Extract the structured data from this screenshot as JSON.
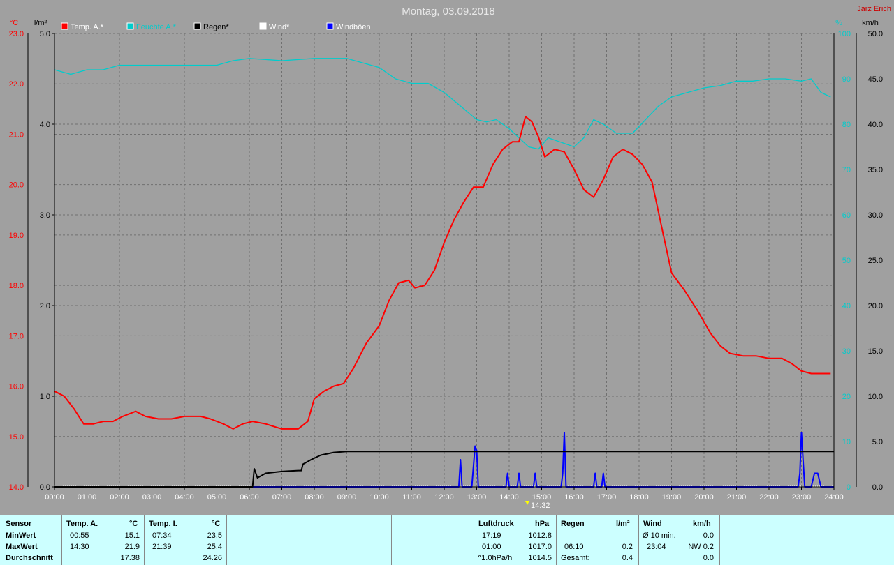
{
  "title": "Montag, 03.09.2018",
  "author": "Jarz Erich",
  "cursor_time": "14:32",
  "colors": {
    "temp": "#ff0000",
    "humidity": "#00cccc",
    "rain": "#000000",
    "wind": "#ffffff",
    "gust": "#0000ff",
    "background": "#a0a0a0",
    "grid": "#707070",
    "stats_bg": "#ccffff"
  },
  "chart_data": {
    "type": "line",
    "title": "Montag, 03.09.2018",
    "x_labels": [
      "00:00",
      "01:00",
      "02:00",
      "03:00",
      "04:00",
      "05:00",
      "06:00",
      "07:00",
      "08:00",
      "09:00",
      "10:00",
      "11:00",
      "12:00",
      "13:00",
      "14:00",
      "15:00",
      "16:00",
      "17:00",
      "18:00",
      "19:00",
      "20:00",
      "21:00",
      "22:00",
      "23:00",
      "24:00"
    ],
    "axes": {
      "temp": {
        "unit": "°C",
        "range": [
          14.0,
          23.0
        ],
        "ticks": [
          "14.0",
          "15.0",
          "16.0",
          "17.0",
          "18.0",
          "19.0",
          "20.0",
          "21.0",
          "22.0",
          "23.0"
        ]
      },
      "rain": {
        "unit": "l/m²",
        "range": [
          0.0,
          5.0
        ],
        "ticks": [
          "0.0",
          "1.0",
          "2.0",
          "3.0",
          "4.0",
          "5.0"
        ]
      },
      "humidity": {
        "unit": "%",
        "range": [
          0,
          100
        ],
        "ticks": [
          "0",
          "10",
          "20",
          "30",
          "40",
          "50",
          "60",
          "70",
          "80",
          "90",
          "100"
        ]
      },
      "wind": {
        "unit": "km/h",
        "range": [
          0.0,
          50.0
        ],
        "ticks": [
          "0.0",
          "5.0",
          "10.0",
          "15.0",
          "20.0",
          "25.0",
          "30.0",
          "35.0",
          "40.0",
          "45.0",
          "50.0"
        ]
      }
    },
    "legend": [
      "Temp. A.*",
      "Feuchte A.*",
      "Regen*",
      "Wind*",
      "Windböen"
    ],
    "grid": true,
    "series": [
      {
        "name": "Temp. A.*",
        "axis": "temp",
        "points": [
          [
            0.0,
            15.9
          ],
          [
            0.3,
            15.8
          ],
          [
            0.6,
            15.55
          ],
          [
            0.9,
            15.25
          ],
          [
            1.2,
            15.25
          ],
          [
            1.5,
            15.3
          ],
          [
            1.8,
            15.3
          ],
          [
            2.1,
            15.4
          ],
          [
            2.5,
            15.5
          ],
          [
            2.8,
            15.4
          ],
          [
            3.2,
            15.35
          ],
          [
            3.6,
            15.35
          ],
          [
            4.0,
            15.4
          ],
          [
            4.5,
            15.4
          ],
          [
            4.8,
            15.35
          ],
          [
            5.2,
            15.25
          ],
          [
            5.5,
            15.15
          ],
          [
            5.8,
            15.25
          ],
          [
            6.1,
            15.3
          ],
          [
            6.5,
            15.25
          ],
          [
            7.0,
            15.15
          ],
          [
            7.5,
            15.15
          ],
          [
            7.8,
            15.3
          ],
          [
            8.0,
            15.75
          ],
          [
            8.3,
            15.9
          ],
          [
            8.6,
            16.0
          ],
          [
            8.9,
            16.05
          ],
          [
            9.2,
            16.35
          ],
          [
            9.6,
            16.85
          ],
          [
            10.0,
            17.2
          ],
          [
            10.3,
            17.7
          ],
          [
            10.6,
            18.05
          ],
          [
            10.9,
            18.1
          ],
          [
            11.1,
            17.95
          ],
          [
            11.4,
            18.0
          ],
          [
            11.7,
            18.3
          ],
          [
            12.0,
            18.85
          ],
          [
            12.3,
            19.3
          ],
          [
            12.6,
            19.65
          ],
          [
            12.9,
            19.95
          ],
          [
            13.2,
            19.95
          ],
          [
            13.5,
            20.4
          ],
          [
            13.8,
            20.7
          ],
          [
            14.1,
            20.85
          ],
          [
            14.3,
            20.85
          ],
          [
            14.5,
            21.35
          ],
          [
            14.7,
            21.25
          ],
          [
            14.9,
            20.95
          ],
          [
            15.1,
            20.55
          ],
          [
            15.4,
            20.7
          ],
          [
            15.7,
            20.65
          ],
          [
            16.0,
            20.3
          ],
          [
            16.3,
            19.9
          ],
          [
            16.6,
            19.75
          ],
          [
            16.9,
            20.1
          ],
          [
            17.2,
            20.55
          ],
          [
            17.5,
            20.7
          ],
          [
            17.8,
            20.6
          ],
          [
            18.1,
            20.4
          ],
          [
            18.4,
            20.05
          ],
          [
            18.7,
            19.15
          ],
          [
            19.0,
            18.25
          ],
          [
            19.4,
            17.9
          ],
          [
            19.8,
            17.5
          ],
          [
            20.2,
            17.05
          ],
          [
            20.5,
            16.8
          ],
          [
            20.8,
            16.65
          ],
          [
            21.2,
            16.6
          ],
          [
            21.6,
            16.6
          ],
          [
            22.0,
            16.55
          ],
          [
            22.4,
            16.55
          ],
          [
            22.7,
            16.45
          ],
          [
            23.0,
            16.3
          ],
          [
            23.3,
            16.25
          ],
          [
            23.6,
            16.25
          ],
          [
            23.9,
            16.25
          ]
        ]
      },
      {
        "name": "Feuchte A.*",
        "axis": "humidity",
        "points": [
          [
            0.0,
            92
          ],
          [
            0.5,
            91
          ],
          [
            1.0,
            92
          ],
          [
            1.5,
            92
          ],
          [
            2.0,
            93
          ],
          [
            3.0,
            93
          ],
          [
            4.0,
            93
          ],
          [
            5.0,
            93
          ],
          [
            5.5,
            94
          ],
          [
            6.0,
            94.5
          ],
          [
            7.0,
            94
          ],
          [
            8.0,
            94.5
          ],
          [
            9.0,
            94.5
          ],
          [
            9.5,
            93.5
          ],
          [
            10.0,
            92.5
          ],
          [
            10.5,
            90
          ],
          [
            11.0,
            89
          ],
          [
            11.5,
            89
          ],
          [
            12.0,
            87
          ],
          [
            12.5,
            84
          ],
          [
            13.0,
            81
          ],
          [
            13.3,
            80.5
          ],
          [
            13.6,
            81
          ],
          [
            14.0,
            79
          ],
          [
            14.3,
            77
          ],
          [
            14.6,
            75
          ],
          [
            14.9,
            74.5
          ],
          [
            15.2,
            77
          ],
          [
            15.6,
            76
          ],
          [
            16.0,
            75
          ],
          [
            16.3,
            77
          ],
          [
            16.6,
            81
          ],
          [
            16.9,
            80
          ],
          [
            17.3,
            78
          ],
          [
            17.8,
            78
          ],
          [
            18.2,
            81
          ],
          [
            18.6,
            84
          ],
          [
            19.0,
            86
          ],
          [
            19.5,
            87
          ],
          [
            20.0,
            88
          ],
          [
            20.5,
            88.5
          ],
          [
            21.0,
            89.5
          ],
          [
            21.5,
            89.5
          ],
          [
            22.0,
            90
          ],
          [
            22.5,
            90
          ],
          [
            23.0,
            89.5
          ],
          [
            23.3,
            90
          ],
          [
            23.6,
            87
          ],
          [
            23.9,
            86
          ]
        ]
      },
      {
        "name": "Regen*",
        "axis": "rain",
        "points": [
          [
            0.0,
            0.0
          ],
          [
            6.1,
            0.0
          ],
          [
            6.15,
            0.2
          ],
          [
            6.25,
            0.1
          ],
          [
            6.5,
            0.15
          ],
          [
            7.0,
            0.17
          ],
          [
            7.5,
            0.18
          ],
          [
            7.6,
            0.18
          ],
          [
            7.65,
            0.25
          ],
          [
            7.9,
            0.3
          ],
          [
            8.2,
            0.35
          ],
          [
            8.6,
            0.38
          ],
          [
            9.0,
            0.39
          ],
          [
            24.0,
            0.39
          ]
        ]
      },
      {
        "name": "Windböen",
        "axis": "wind",
        "points": [
          [
            0,
            0
          ],
          [
            12.45,
            0
          ],
          [
            12.5,
            3.0
          ],
          [
            12.55,
            0
          ],
          [
            12.85,
            0
          ],
          [
            12.95,
            4.5
          ],
          [
            13.0,
            4.0
          ],
          [
            13.05,
            0
          ],
          [
            13.9,
            0
          ],
          [
            13.95,
            1.5
          ],
          [
            14.0,
            0
          ],
          [
            14.25,
            0
          ],
          [
            14.3,
            1.5
          ],
          [
            14.35,
            0
          ],
          [
            14.75,
            0
          ],
          [
            14.8,
            1.5
          ],
          [
            14.85,
            0
          ],
          [
            15.6,
            0
          ],
          [
            15.65,
            1.5
          ],
          [
            15.7,
            6.0
          ],
          [
            15.75,
            0
          ],
          [
            16.6,
            0
          ],
          [
            16.65,
            1.5
          ],
          [
            16.7,
            0
          ],
          [
            16.85,
            0
          ],
          [
            16.9,
            1.5
          ],
          [
            16.95,
            0
          ],
          [
            22.9,
            0
          ],
          [
            22.95,
            1.5
          ],
          [
            23.0,
            6.0
          ],
          [
            23.05,
            3.0
          ],
          [
            23.1,
            0
          ],
          [
            23.3,
            0
          ],
          [
            23.4,
            1.5
          ],
          [
            23.5,
            1.5
          ],
          [
            23.6,
            0
          ],
          [
            24,
            0
          ]
        ]
      }
    ]
  },
  "stats": {
    "sensor_label": "Sensor",
    "minwert_label": "MinWert",
    "maxwert_label": "MaxWert",
    "durchschnitt_label": "Durchschnitt",
    "temp_a": {
      "header": "Temp. A.",
      "unit": "°C",
      "min_time": "00:55",
      "min": "15.1",
      "max_time": "14:30",
      "max": "21.9",
      "avg": "17.38"
    },
    "temp_i": {
      "header": "Temp. I.",
      "unit": "°C",
      "min_time": "07:34",
      "min": "23.5",
      "max_time": "21:39",
      "max": "25.4",
      "avg": "24.26"
    },
    "pressure": {
      "header": "Luftdruck",
      "unit": "hPa",
      "min_time": "17:19",
      "min": "1012.8",
      "max_time": "01:00",
      "max": "1017.0",
      "trend_label": "^1.0hPa/h",
      "trend": "1014.5"
    },
    "rain": {
      "header": "Regen",
      "unit": "l/m²",
      "max_time": "06:10",
      "max": "0.2",
      "total_label": "Gesamt:",
      "total": "0.4"
    },
    "wind": {
      "header": "Wind",
      "unit": "km/h",
      "avg_label": "Ø 10 min.",
      "avg": "0.0",
      "max_time": "23:04",
      "max": "NW 0.2",
      "last": "0.0"
    }
  }
}
